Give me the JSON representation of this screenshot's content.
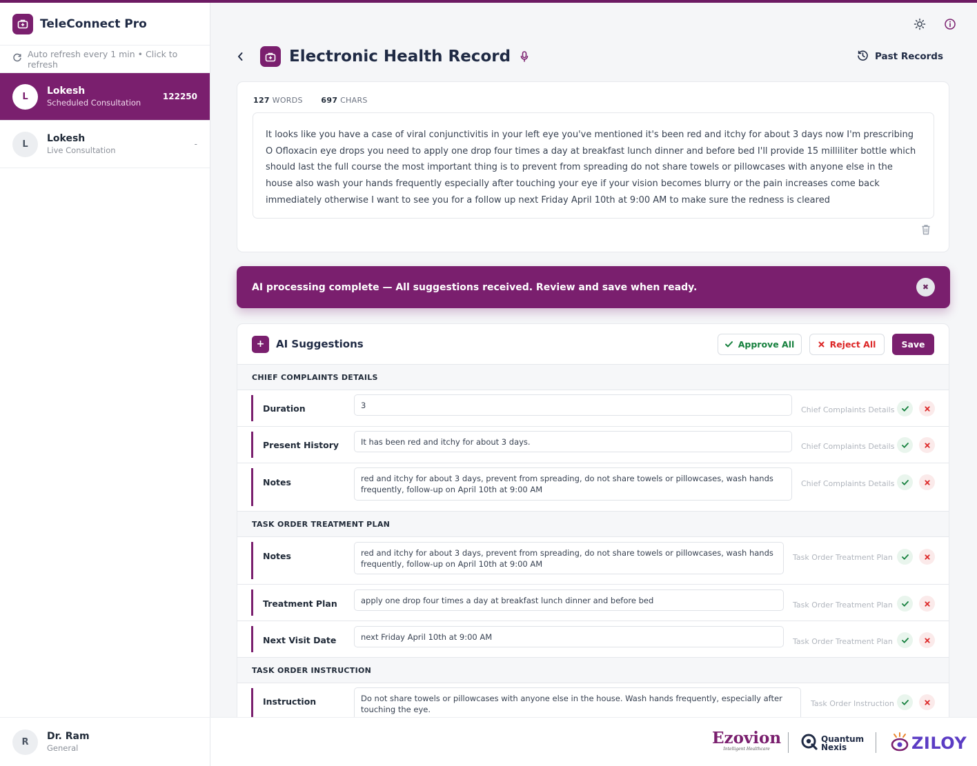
{
  "app": {
    "name": "TeleConnect Pro",
    "refresh_text": "Auto refresh every 1 min • Click to refresh"
  },
  "patients": [
    {
      "initial": "L",
      "name": "Lokesh",
      "type": "Scheduled Consultation",
      "id": "122250",
      "active": true
    },
    {
      "initial": "L",
      "name": "Lokesh",
      "type": "Live Consultation",
      "id": "-",
      "active": false
    }
  ],
  "doctor": {
    "initial": "R",
    "name": "Dr. Ram",
    "role": "General"
  },
  "header": {
    "title": "Electronic Health Record",
    "past_records": "Past Records"
  },
  "transcript": {
    "word_count": "127",
    "word_label": "WORDS",
    "char_count": "697",
    "char_label": "CHARS",
    "text": "It looks like you have a case of viral conjunctivitis in your left eye you've mentioned it's been red and itchy for about 3 days now I'm prescribing O Ofloxacin eye drops you need to apply one drop four times a day at breakfast lunch dinner and before bed I'll provide 15 milliliter bottle which should last the full course the most important thing is to prevent from spreading do not share towels or pillowcases with anyone else in the house also wash your hands frequently especially after touching your eye if your vision becomes blurry or the pain increases come back immediately otherwise I want to see you for a follow up next Friday April 10th at 9:00 AM to make sure the redness is cleared"
  },
  "banner": {
    "text": "AI processing complete — All suggestions received. Review and save when ready.",
    "close": "✖"
  },
  "suggestions": {
    "title": "AI Suggestions",
    "approve_all": "Approve All",
    "reject_all": "Reject All",
    "save": "Save",
    "sections": [
      {
        "title": "CHIEF COMPLAINTS DETAILS",
        "rows": [
          {
            "label": "Duration",
            "value": "3",
            "category": "Chief Complaints Details"
          },
          {
            "label": "Present History",
            "value": "It has been red and itchy for about 3 days.",
            "category": "Chief Complaints Details"
          },
          {
            "label": "Notes",
            "value": "red and itchy for about 3 days, prevent from spreading, do not share towels or pillowcases, wash hands frequently, follow-up on April 10th at 9:00 AM",
            "category": "Chief Complaints Details"
          }
        ]
      },
      {
        "title": "TASK ORDER TREATMENT PLAN",
        "rows": [
          {
            "label": "Notes",
            "value": "red and itchy for about 3 days, prevent from spreading, do not share towels or pillowcases, wash hands frequently, follow-up on April 10th at 9:00 AM",
            "category": "Task Order Treatment Plan"
          },
          {
            "label": "Treatment Plan",
            "value": "apply one drop four times a day at breakfast lunch dinner and before bed",
            "category": "Task Order Treatment Plan"
          },
          {
            "label": "Next Visit Date",
            "value": "next Friday April 10th at 9:00 AM",
            "category": "Task Order Treatment Plan"
          }
        ]
      },
      {
        "title": "TASK ORDER INSTRUCTION",
        "rows": [
          {
            "label": "Instruction",
            "value": "Do not share towels or pillowcases with anyone else in the house. Wash hands frequently, especially after touching the eye.",
            "category": "Task Order Instruction"
          }
        ]
      }
    ]
  },
  "footer": {
    "ezovion": "Ezovion",
    "ezovion_tagline": "Intelligent Healthcare",
    "quantum_line1": "Quantum",
    "quantum_line2": "Nexis",
    "ziloy": "ZILOY"
  },
  "colors": {
    "brand": "#7a1f6e",
    "approve": "#15803d",
    "reject": "#dc2626"
  },
  "icons": {
    "brand": "medical-bag-icon",
    "refresh": "refresh-icon",
    "theme": "sun-icon",
    "info": "info-icon",
    "back": "chevron-left-icon",
    "mic": "microphone-icon",
    "history": "history-icon",
    "delete": "trash-icon",
    "approve": "check-icon",
    "reject": "x-icon",
    "add": "plus-icon"
  }
}
